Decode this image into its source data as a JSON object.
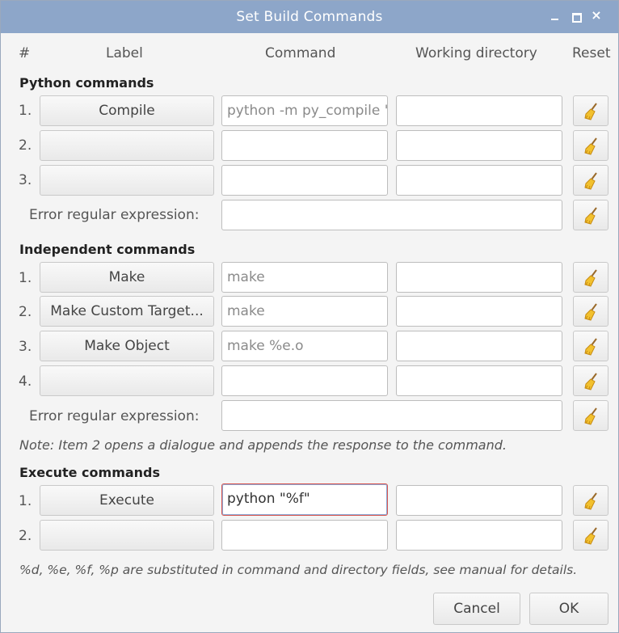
{
  "window": {
    "title": "Set Build Commands",
    "controls": [
      "minimize-icon",
      "maximize-icon",
      "close-icon"
    ],
    "close_glyph": "×"
  },
  "headers": {
    "num": "#",
    "label": "Label",
    "command": "Command",
    "directory": "Working directory",
    "reset": "Reset"
  },
  "python": {
    "title": "Python commands",
    "rows": [
      {
        "num": "1.",
        "label": "Compile",
        "command": "python -m py_compile \"%f\"",
        "dir": ""
      },
      {
        "num": "2.",
        "label": "",
        "command": "",
        "dir": ""
      },
      {
        "num": "3.",
        "label": "",
        "command": "",
        "dir": ""
      }
    ],
    "error_label": "Error regular expression:",
    "error_value": ""
  },
  "independent": {
    "title": "Independent commands",
    "rows": [
      {
        "num": "1.",
        "label": "Make",
        "command": "make",
        "dir": ""
      },
      {
        "num": "2.",
        "label": "Make Custom Target...",
        "command": "make",
        "dir": ""
      },
      {
        "num": "3.",
        "label": "Make Object",
        "command": "make %e.o",
        "dir": ""
      },
      {
        "num": "4.",
        "label": "",
        "command": "",
        "dir": ""
      }
    ],
    "error_label": "Error regular expression:",
    "error_value": "",
    "note": "Note: Item 2 opens a dialogue and appends the response to the command."
  },
  "execute": {
    "title": "Execute commands",
    "rows": [
      {
        "num": "1.",
        "label": "Execute",
        "command": "python \"%f\"",
        "dir": ""
      },
      {
        "num": "2.",
        "label": "",
        "command": "",
        "dir": ""
      }
    ],
    "note": "%d, %e, %f, %p are substituted in command and directory fields, see manual for details."
  },
  "buttons": {
    "cancel": "Cancel",
    "ok": "OK"
  },
  "reset_icon": "broom-icon",
  "colors": {
    "titlebar": "#8da6c9",
    "focus_border": "#d9554f"
  }
}
